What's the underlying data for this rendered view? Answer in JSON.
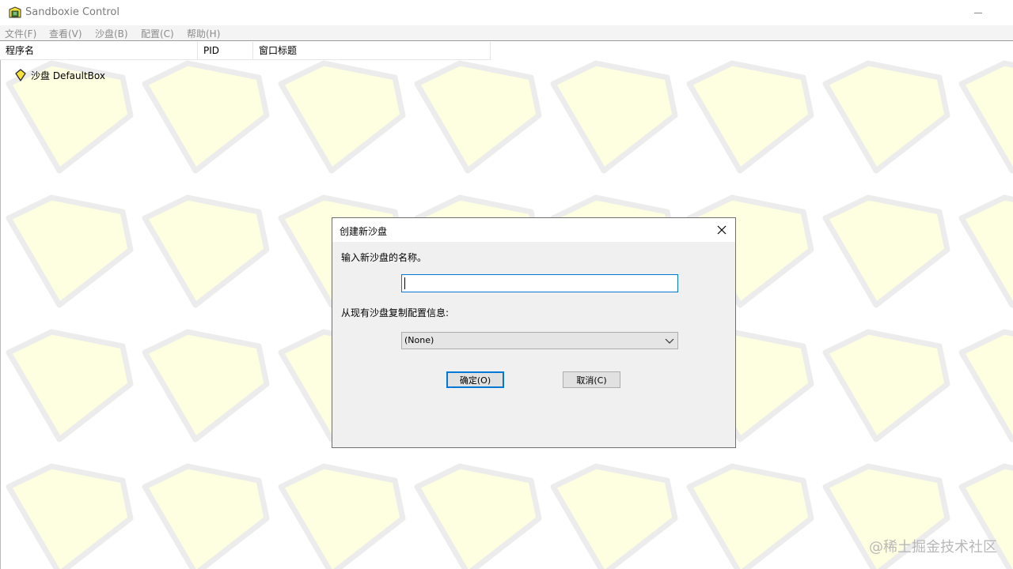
{
  "window": {
    "title": "Sandboxie Control"
  },
  "menu": {
    "items": [
      {
        "label": "文件(F)"
      },
      {
        "label": "查看(V)"
      },
      {
        "label": "沙盘(B)"
      },
      {
        "label": "配置(C)"
      },
      {
        "label": "帮助(H)"
      }
    ]
  },
  "columns": {
    "name": "程序名",
    "pid": "PID",
    "title": "窗口标题"
  },
  "tree": {
    "sandbox_label": "沙盘 DefaultBox"
  },
  "dialog": {
    "title": "创建新沙盘",
    "name_prompt": "输入新沙盘的名称。",
    "name_value": "",
    "copy_prompt": "从现有沙盘复制配置信息:",
    "copy_selected": "(None)",
    "ok_label": "确定(O)",
    "cancel_label": "取消(C)"
  },
  "watermark": "@稀土掘金技术社区",
  "colors": {
    "accent": "#0078d7",
    "watermark_fill": "#fefee0",
    "watermark_stroke": "#ececec",
    "dialog_bg": "#f0f0f0"
  },
  "icons": {
    "app": "sandboxie-icon",
    "sandbox": "sandbox-diamond-icon",
    "close": "close-icon",
    "dropdown": "chevron-down-icon"
  }
}
